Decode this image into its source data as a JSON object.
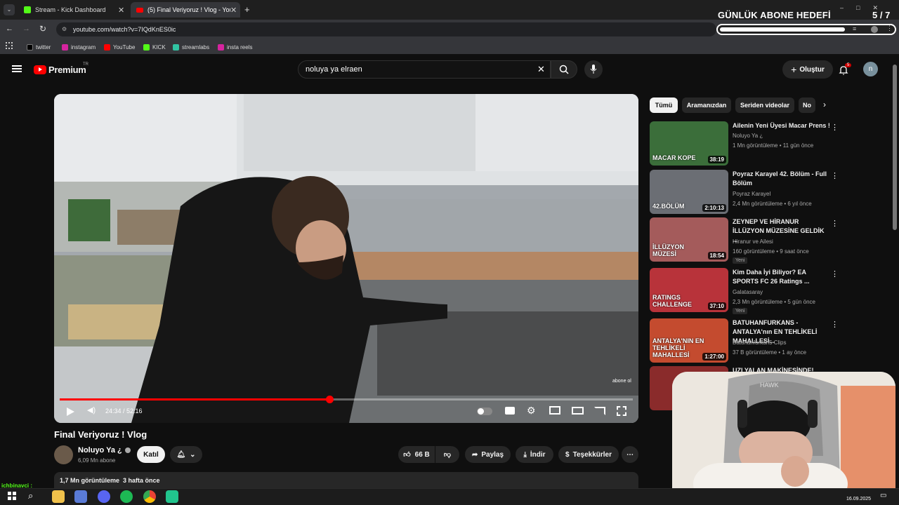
{
  "browser": {
    "tabs": [
      {
        "label": "Stream - Kick Dashboard"
      },
      {
        "label": "(5) Final Veriyoruz ! Vlog - YouT"
      }
    ],
    "url": "youtube.com/watch?v=7IQdKnES0ic",
    "bookmarks": [
      "twitter",
      "instagram",
      "YouTube",
      "KICK",
      "streamlabs",
      "insta reels"
    ]
  },
  "overlay": {
    "goal_title": "GÜNLÜK ABONE HEDEFİ",
    "goal_count": "5 / 7",
    "goal_progress": 0.71
  },
  "header": {
    "logo": "Premium",
    "logo_region": "TR",
    "search_value": "noluya ya elraen",
    "create_label": "Oluştur",
    "notif_count": "5",
    "avatar_letter": "n"
  },
  "player": {
    "time": "24:34 / 52:16",
    "progress": 0.47,
    "watermark": "abone ol"
  },
  "video": {
    "title": "Final Veriyoruz ! Vlog",
    "channel": "Noluyo Ya ¿",
    "subs": "6,09 Mn abone",
    "join_label": "Katıl",
    "likes": "66 B",
    "share_label": "Paylaş",
    "download_label": "İndir",
    "thanks_label": "Teşekkürler",
    "views": "1,7 Mn görüntüleme",
    "age": "3 hafta önce"
  },
  "chips": [
    "Tümü",
    "Aramanızdan",
    "Seriden videolar",
    "No"
  ],
  "recommendations": [
    {
      "title": "Ailenin Yeni Üyesi Macar Prens !",
      "channel": "Noluyo Ya ¿",
      "meta": "1 Mn görüntüleme • 11 gün önce",
      "duration": "38:19",
      "badge": "",
      "thumb_text": "MACAR KOPE",
      "thumb_color": "#3b6e3a"
    },
    {
      "title": "Poyraz Karayel 42. Bölüm - Full Bölüm",
      "channel": "Poyraz Karayel",
      "meta": "2,4 Mn görüntüleme • 6 yıl önce",
      "duration": "2:10:13",
      "badge": "",
      "thumb_text": "42.BÖLÜM",
      "thumb_color": "#6b6e74"
    },
    {
      "title": "ZEYNEP VE HİRANUR İLLÜZYON MÜZESİNE GELDİK ...",
      "channel": "Hiranur ve Ailesi",
      "meta": "160 görüntüleme • 9 saat önce",
      "duration": "18:54",
      "badge": "Yeni",
      "thumb_text": "İLLÜZYON MÜZESİ",
      "thumb_color": "#a45b5b"
    },
    {
      "title": "Kim Daha İyi Biliyor? EA SPORTS FC 26 Ratings ...",
      "channel": "Galatasaray",
      "meta": "2,3 Mn görüntüleme • 5 gün önce",
      "duration": "37:10",
      "badge": "Yeni",
      "thumb_text": "RATINGS CHALLENGE",
      "thumb_color": "#b8333a"
    },
    {
      "title": "BATUHANFURKANS - ANTALYA'nın EN TEHLİKELİ MAHALLESİ...",
      "channel": "Batuhanfurkan5 Clips",
      "meta": "37 B görüntüleme • 1 ay önce",
      "duration": "1:27:00",
      "badge": "",
      "thumb_text": "ANTALYA'NIN EN TEHLİKELİ MAHALLESİ",
      "thumb_color": "#c44b2f"
    },
    {
      "title": "UZI YALAN MAKİNESİNDE!",
      "channel": "",
      "meta": "",
      "duration": "",
      "badge": "",
      "thumb_text": "",
      "thumb_color": "#8a2b2b"
    }
  ],
  "streamer": {
    "chat_user": "ichbinavci :"
  },
  "taskbar": {
    "time": "16.09.2025"
  }
}
